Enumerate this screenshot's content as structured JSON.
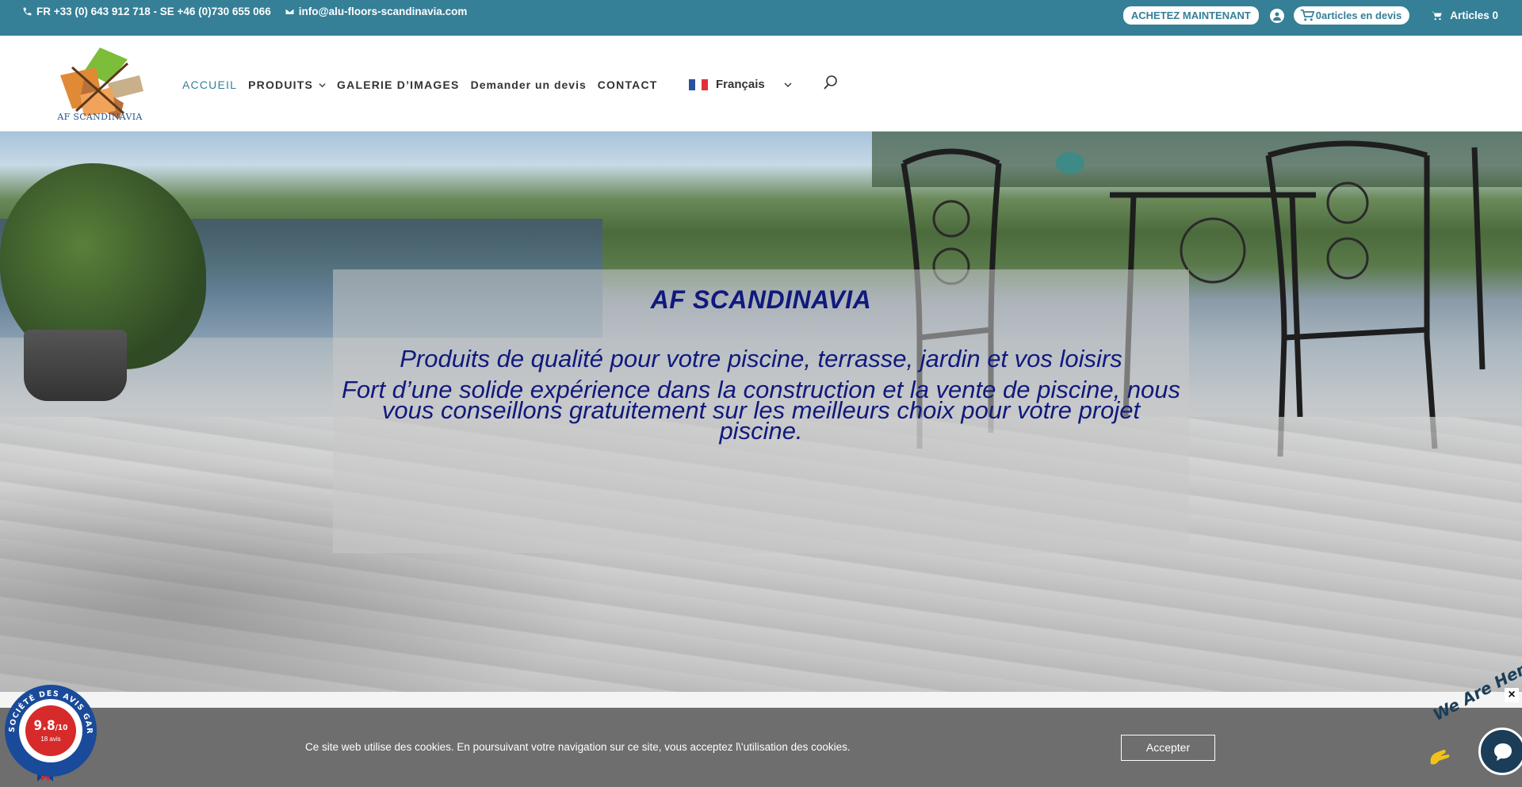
{
  "topbar": {
    "phone": "FR +33 (0) 643 912 718 - SE +46 (0)730 655 066",
    "email": "info@alu-floors-scandinavia.com",
    "buy_now": "ACHETEZ MAINTENANT",
    "quote_cart": "0articles en devis",
    "articles": "Articles 0"
  },
  "header": {
    "logo_text": "AF SCANDINAVIA",
    "nav": [
      {
        "label": "ACCUEIL",
        "active": true
      },
      {
        "label": "PRODUITS",
        "dropdown": true
      },
      {
        "label": "GALERIE D’IMAGES"
      },
      {
        "label": "Demander un devis"
      },
      {
        "label": "CONTACT"
      }
    ],
    "language": "Français"
  },
  "hero": {
    "title": "AF SCANDINAVIA",
    "subtitle": "Produits de qualité pour votre piscine, terrasse, jardin et vos loisirs",
    "text": "Fort d’une solide expérience dans la construction et la vente de piscine, nous vous conseillons gratuitement sur les meilleurs choix pour votre projet piscine."
  },
  "cookie": {
    "text": "Ce site web utilise des cookies. En poursuivant votre navigation sur ce site, vous acceptez l\\'utilisation des cookies.",
    "accept": "Accepter",
    "close": "×"
  },
  "badge": {
    "ring_text": "SOCIÉTÉ DES AVIS GARANTIS",
    "score": "9.8",
    "score_max": "/10",
    "reviews": "18 avis"
  },
  "chat": {
    "label": "We Are Here!"
  },
  "colors": {
    "topbar": "#357f97",
    "hero_text": "#10197c",
    "accent": "#357f97"
  }
}
